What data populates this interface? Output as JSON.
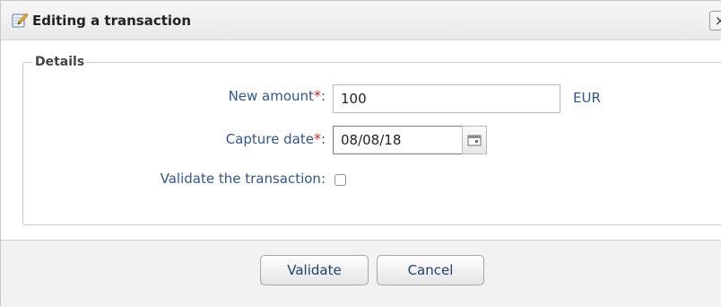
{
  "dialog": {
    "title": "Editing a transaction",
    "close_glyph": "×",
    "title_icon": "edit-icon",
    "close_icon": "close-icon"
  },
  "details": {
    "legend": "Details",
    "fields": {
      "new_amount": {
        "label": "New amount",
        "required_mark": "*",
        "colon": ":",
        "value": "100",
        "unit": "EUR"
      },
      "capture_date": {
        "label": "Capture date",
        "required_mark": "*",
        "colon": ":",
        "value": "08/08/18",
        "picker_icon": "calendar-icon"
      },
      "validate_transaction": {
        "label": "Validate the transaction:",
        "checked": false
      }
    }
  },
  "footer": {
    "validate_label": "Validate",
    "cancel_label": "Cancel"
  },
  "colors": {
    "label_text": "#2f5597",
    "required": "#e02020",
    "button_text": "#1f3f73"
  }
}
